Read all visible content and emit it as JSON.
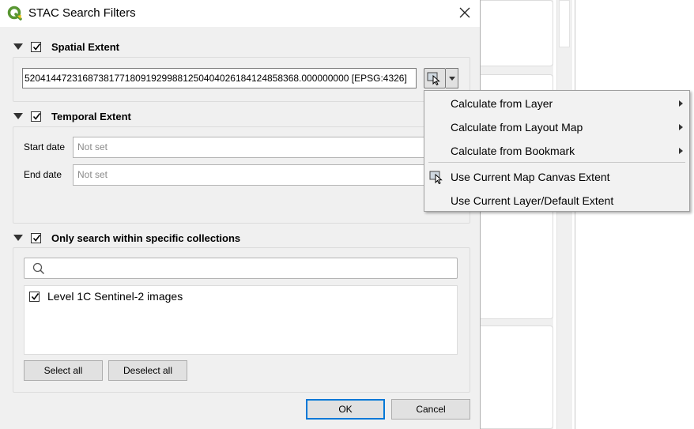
{
  "window": {
    "title": "STAC Search Filters"
  },
  "spatial": {
    "title": "Spatial Extent",
    "extent_text": "5204144723168738177180919299881250404026184124858368.000000000 [EPSG:4326]"
  },
  "temporal": {
    "title": "Temporal Extent",
    "start_label": "Start date",
    "start_value": "Not set",
    "end_label": "End date",
    "end_value": "Not set"
  },
  "collections": {
    "title": "Only search within specific collections",
    "search_placeholder": "",
    "items": [
      {
        "label": "Level 1C Sentinel-2 images",
        "checked": true
      }
    ],
    "select_all_label": "Select all",
    "deselect_all_label": "Deselect all"
  },
  "footer": {
    "ok_label": "OK",
    "cancel_label": "Cancel"
  },
  "extent_menu": {
    "items": [
      {
        "label": "Calculate from Layer",
        "submenu": true
      },
      {
        "label": "Calculate from Layout Map",
        "submenu": true
      },
      {
        "label": "Calculate from Bookmark",
        "submenu": true
      },
      {
        "label": "Use Current Map Canvas Extent",
        "icon": "map-canvas-extent-icon"
      },
      {
        "label": "Use Current Layer/Default Extent"
      }
    ]
  },
  "colors": {
    "qgis_green": "#589632",
    "qgis_yellow": "#f0c419",
    "focus_blue": "#0078d7"
  }
}
